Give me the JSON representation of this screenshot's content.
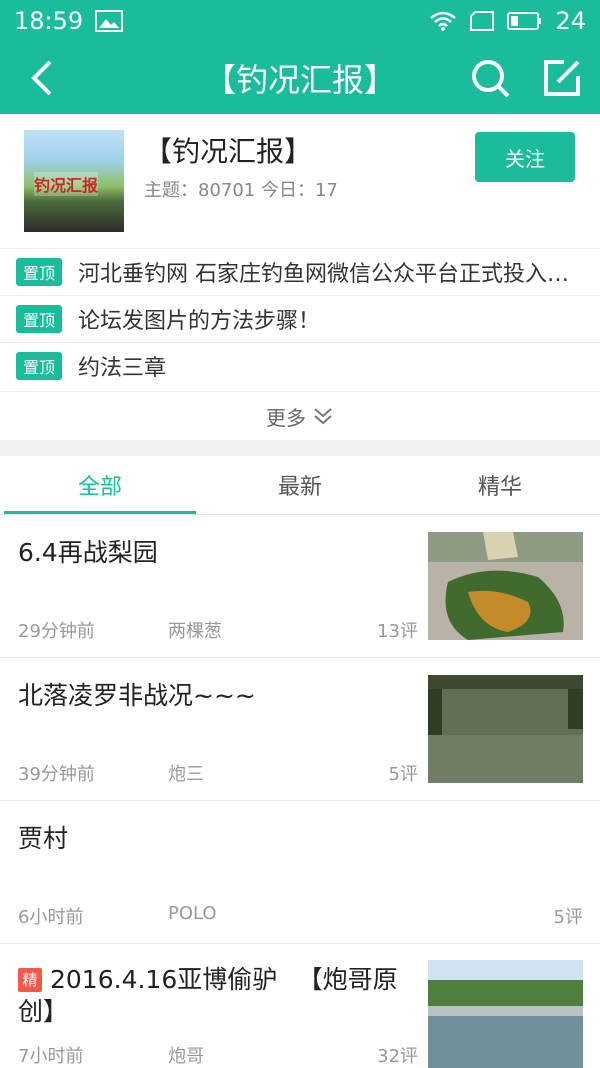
{
  "status_bar": {
    "time": "18:59",
    "battery": "24"
  },
  "app_bar": {
    "title": "【钓况汇报】"
  },
  "forum": {
    "thumb_text": "钓况汇报",
    "name": "【钓况汇报】",
    "stats": "主题：80701  今日：17",
    "follow_label": "关注"
  },
  "pinned": [
    {
      "badge": "置顶",
      "text": "河北垂钓网 石家庄钓鱼网微信公众平台正式投入使用"
    },
    {
      "badge": "置顶",
      "text": "论坛发图片的方法步骤！"
    },
    {
      "badge": "置顶",
      "text": "约法三章"
    }
  ],
  "more_label": "更多",
  "tabs": [
    {
      "label": "全部"
    },
    {
      "label": "最新"
    },
    {
      "label": "精华"
    }
  ],
  "posts": [
    {
      "title": "6.4再战梨园",
      "time": "29分钟前",
      "author": "两棵葱",
      "comments": "13评"
    },
    {
      "title": "北落凌罗非战况~~~",
      "time": "39分钟前",
      "author": "炮三",
      "comments": "5评"
    },
    {
      "title": "贾村",
      "time": "6小时前",
      "author": "POLO",
      "comments": "5评"
    },
    {
      "badge": "精",
      "title": "2016.4.16亚博偷驴 　【炮哥原创】",
      "time": "7小时前",
      "author": "炮哥",
      "comments": "32评"
    }
  ],
  "colors": {
    "accent": "#1abc9c",
    "badge_red": "#f05a4a"
  }
}
